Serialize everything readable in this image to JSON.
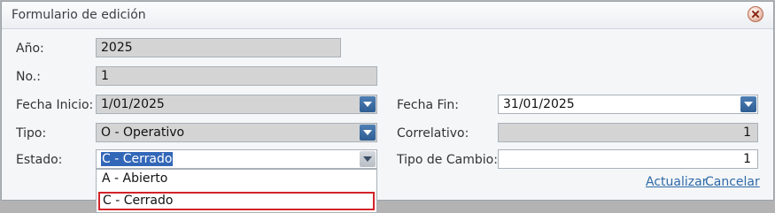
{
  "window": {
    "title": "Formulario de edición"
  },
  "form": {
    "anio": {
      "label": "Año:",
      "value": "2025"
    },
    "numero": {
      "label": "No.:",
      "value": "1"
    },
    "fecha_inicio": {
      "label": "Fecha Inicio:",
      "value": "1/01/2025"
    },
    "fecha_fin": {
      "label": "Fecha Fin:",
      "value": "31/01/2025"
    },
    "tipo": {
      "label": "Tipo:",
      "value": "O - Operativo"
    },
    "correlativo": {
      "label": "Correlativo:",
      "value": "1"
    },
    "estado": {
      "label": "Estado:",
      "value": "C - Cerrado"
    },
    "tipo_cambio": {
      "label": "Tipo de Cambio:",
      "value": "1"
    }
  },
  "estado_options": [
    "A - Abierto",
    "C - Cerrado"
  ],
  "actions": {
    "update": "Actualizar",
    "cancel": "Cancelar"
  },
  "icons": {
    "close": "close-icon",
    "dropdown": "chevron-down-icon"
  },
  "colors": {
    "accent": "#2e5d92",
    "selection": "#3267b8",
    "highlight_border": "#d3232a",
    "link": "#2e6aa8"
  }
}
